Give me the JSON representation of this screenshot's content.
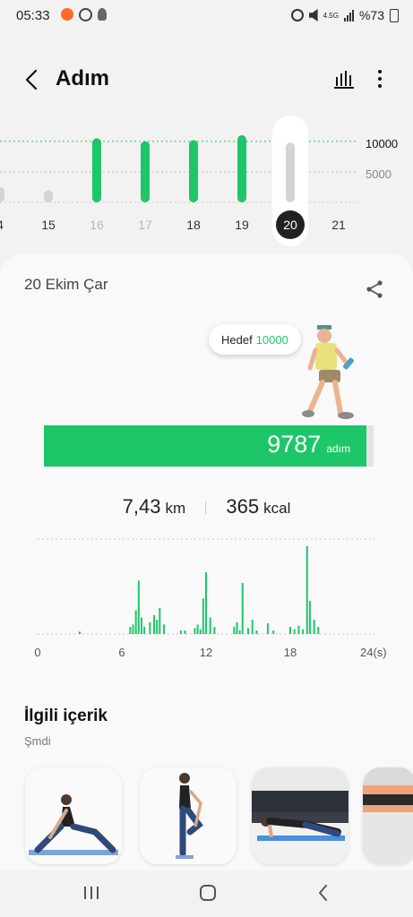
{
  "status_bar": {
    "time": "05:33",
    "battery": "%73",
    "network": "4.5G"
  },
  "app_bar": {
    "title": "Adım",
    "back_icon": "back-arrow-icon",
    "chart_icon": "bar-chart-icon",
    "more_icon": "more-vertical-icon"
  },
  "week_chart": {
    "days": [
      {
        "label": "4",
        "value": 2500,
        "style": "normal"
      },
      {
        "label": "15",
        "value": 2000,
        "style": "normal"
      },
      {
        "label": "16",
        "value": 10500,
        "style": "light"
      },
      {
        "label": "17",
        "value": 10000,
        "style": "light"
      },
      {
        "label": "18",
        "value": 10200,
        "style": "normal"
      },
      {
        "label": "19",
        "value": 11000,
        "style": "normal"
      },
      {
        "label": "20",
        "value": 9787,
        "style": "selected"
      },
      {
        "label": "21",
        "value": 0,
        "style": "normal"
      }
    ],
    "goal_label": "10000",
    "mid_label": "5000",
    "goal_color": "#1ec66a",
    "inactive_color": "#d4d4d4"
  },
  "card": {
    "date": "20 Ekim Çar",
    "share_icon": "share-icon",
    "goal_prefix": "Hedef",
    "goal_value": "10000",
    "steps_value": "9787",
    "steps_unit": "adım",
    "progress_fraction": 0.9787,
    "distance_value": "7,43",
    "distance_unit": "km",
    "calories_value": "365",
    "calories_unit": "kcal"
  },
  "chart_data": {
    "type": "bar",
    "x_ticks": [
      "0",
      "6",
      "12",
      "18",
      "24(s)"
    ],
    "xlim": [
      0,
      24
    ],
    "values": [
      {
        "h": 3.0,
        "v": 2
      },
      {
        "h": 6.6,
        "v": 6
      },
      {
        "h": 6.8,
        "v": 8
      },
      {
        "h": 7.0,
        "v": 20
      },
      {
        "h": 7.2,
        "v": 45
      },
      {
        "h": 7.4,
        "v": 14
      },
      {
        "h": 7.6,
        "v": 6
      },
      {
        "h": 8.0,
        "v": 10
      },
      {
        "h": 8.3,
        "v": 16
      },
      {
        "h": 8.5,
        "v": 12
      },
      {
        "h": 8.7,
        "v": 22
      },
      {
        "h": 9.0,
        "v": 8
      },
      {
        "h": 10.2,
        "v": 3
      },
      {
        "h": 10.5,
        "v": 3
      },
      {
        "h": 11.2,
        "v": 5
      },
      {
        "h": 11.4,
        "v": 8
      },
      {
        "h": 11.6,
        "v": 4
      },
      {
        "h": 11.8,
        "v": 30
      },
      {
        "h": 12.0,
        "v": 52
      },
      {
        "h": 12.3,
        "v": 14
      },
      {
        "h": 12.6,
        "v": 6
      },
      {
        "h": 14.0,
        "v": 6
      },
      {
        "h": 14.2,
        "v": 10
      },
      {
        "h": 14.4,
        "v": 3
      },
      {
        "h": 14.6,
        "v": 43
      },
      {
        "h": 15.0,
        "v": 5
      },
      {
        "h": 15.3,
        "v": 12
      },
      {
        "h": 15.6,
        "v": 3
      },
      {
        "h": 16.4,
        "v": 9
      },
      {
        "h": 16.8,
        "v": 3
      },
      {
        "h": 18.0,
        "v": 6
      },
      {
        "h": 18.3,
        "v": 4
      },
      {
        "h": 18.6,
        "v": 7
      },
      {
        "h": 18.9,
        "v": 4
      },
      {
        "h": 19.2,
        "v": 74
      },
      {
        "h": 19.4,
        "v": 28
      },
      {
        "h": 19.7,
        "v": 12
      },
      {
        "h": 20.0,
        "v": 6
      }
    ]
  },
  "related": {
    "title": "İlgili içerik",
    "subtitle": "Şmdi",
    "items": [
      {
        "name": "stretch-lunge"
      },
      {
        "name": "standing-quad-stretch"
      },
      {
        "name": "plank-on-mat"
      },
      {
        "name": "plank-cropped"
      }
    ]
  },
  "nav": {
    "recent": "recent-apps-icon",
    "home": "home-icon",
    "back": "back-icon"
  }
}
